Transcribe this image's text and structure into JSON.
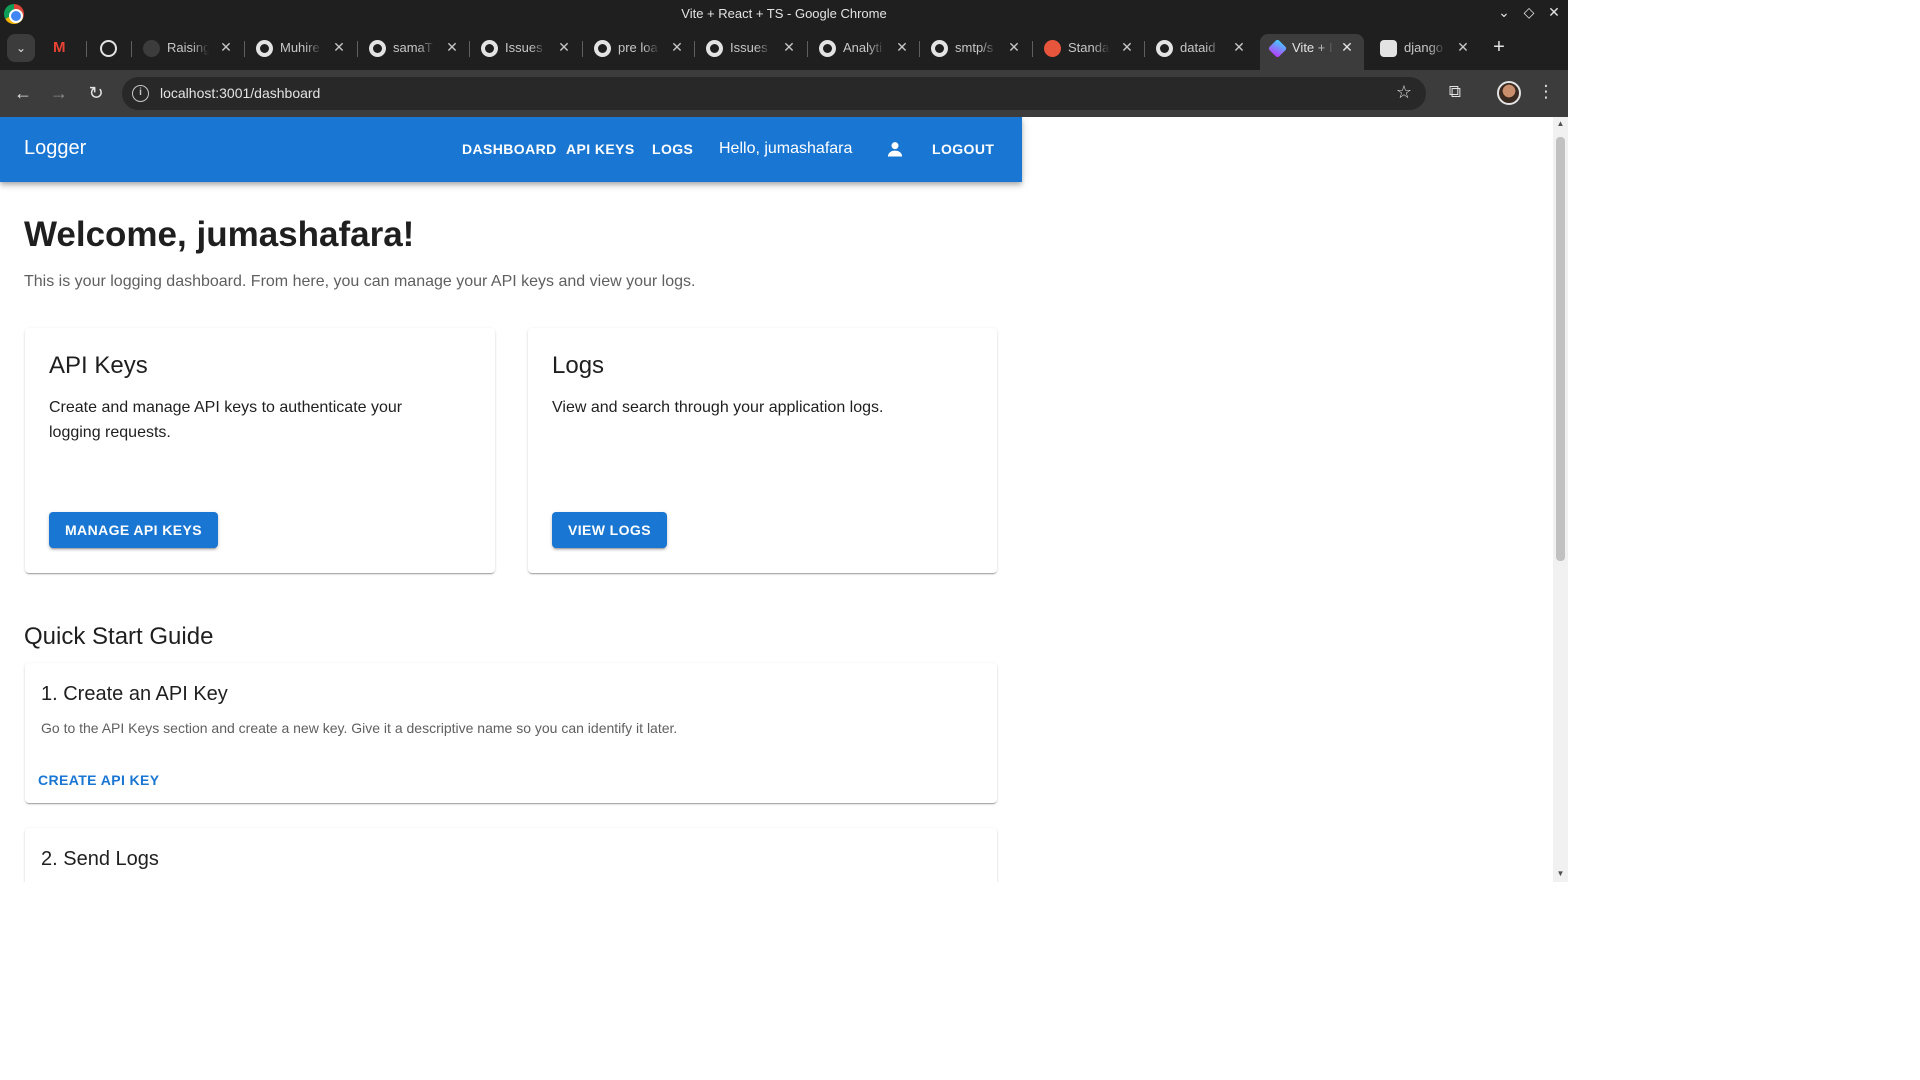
{
  "browser": {
    "window_title": "Vite + React + TS - Google Chrome",
    "tabs": [
      {
        "label": "",
        "icon": "gmail-icon"
      },
      {
        "label": "",
        "icon": "openai-icon"
      },
      {
        "label": "Raising",
        "icon": "loading-icon"
      },
      {
        "label": "Muhire",
        "icon": "github-icon"
      },
      {
        "label": "samaT",
        "icon": "github-icon"
      },
      {
        "label": "Issues",
        "icon": "github-icon"
      },
      {
        "label": "pre loa",
        "icon": "github-icon"
      },
      {
        "label": "Issues",
        "icon": "github-icon"
      },
      {
        "label": "Analyti",
        "icon": "github-icon"
      },
      {
        "label": "smtp/s",
        "icon": "github-icon"
      },
      {
        "label": "Standa",
        "icon": "red-app-icon"
      },
      {
        "label": "dataid",
        "icon": "github-icon"
      },
      {
        "label": "Vite + I",
        "icon": "vite-icon",
        "active": true
      },
      {
        "label": "django",
        "icon": "django-icon"
      }
    ],
    "url": "localhost:3001/dashboard"
  },
  "app": {
    "brand": "Logger",
    "nav": {
      "dashboard": "DASHBOARD",
      "api_keys": "API KEYS",
      "logs": "LOGS",
      "hello": "Hello, jumashafara",
      "logout": "LOGOUT"
    },
    "accent_color": "#1976d2"
  },
  "main": {
    "welcome": "Welcome, jumashafara!",
    "intro": "This is your logging dashboard. From here, you can manage your API keys and view your logs.",
    "cards": [
      {
        "title": "API Keys",
        "description": "Create and manage API keys to authenticate your logging requests.",
        "button": "MANAGE API KEYS"
      },
      {
        "title": "Logs",
        "description": "View and search through your application logs.",
        "button": "VIEW LOGS"
      }
    ],
    "quick_start": {
      "title": "Quick Start Guide",
      "steps": [
        {
          "title": "1. Create an API Key",
          "description": "Go to the API Keys section and create a new key. Give it a descriptive name so you can identify it later.",
          "action": "CREATE API KEY"
        },
        {
          "title": "2. Send Logs",
          "description": "",
          "action": ""
        }
      ]
    }
  }
}
